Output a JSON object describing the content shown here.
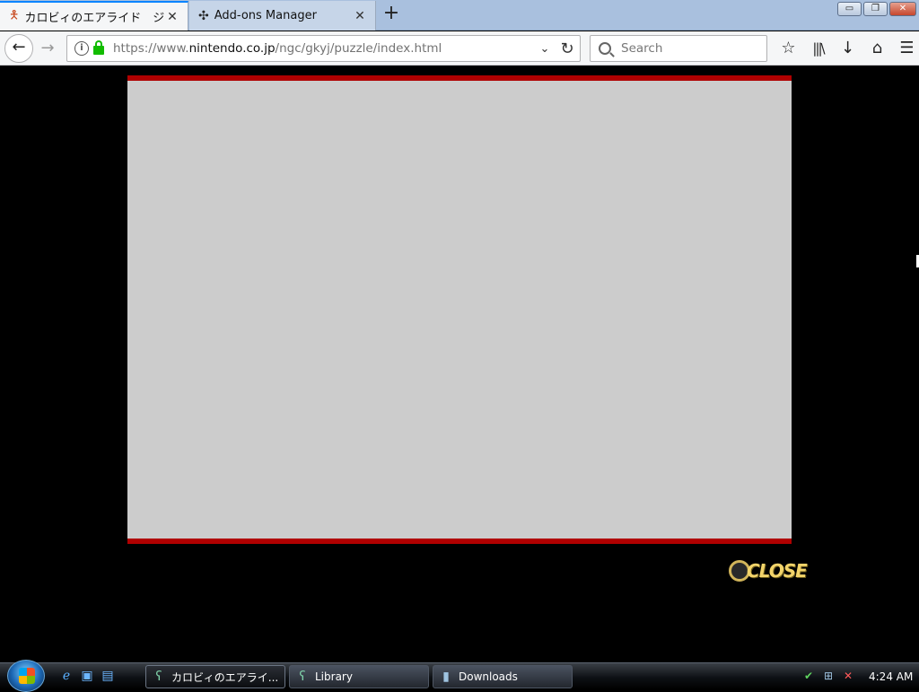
{
  "browser": {
    "tabs": [
      {
        "title": "カロビィのエアライド　ジ",
        "icon": "mario-favicon",
        "active": true
      },
      {
        "title": "Add-ons Manager",
        "icon": "puzzle-icon",
        "active": false
      }
    ],
    "new_tab_label": "+",
    "window_controls": {
      "minimize": "▭",
      "restore": "❐",
      "close": "✕"
    },
    "url": {
      "prefix": "https://www.",
      "host": "nintendo.co.jp",
      "path": "/ngc/gkyj/puzzle/index.html"
    },
    "search_placeholder": "Search",
    "toolbar_icons": [
      "bookmark-star-icon",
      "library-icon",
      "downloads-icon",
      "home-icon",
      "menu-icon"
    ]
  },
  "page": {
    "close_button_label": "CLOSE",
    "colors": {
      "panel": "#cccccc",
      "border": "#b00000",
      "close_text": "#f3d46a"
    }
  },
  "taskbar": {
    "tasks": [
      {
        "label": "カロビィのエアライ...",
        "active": true
      },
      {
        "label": "Library",
        "active": false
      },
      {
        "label": "Downloads",
        "active": false
      }
    ],
    "clock": "4:24 AM"
  }
}
